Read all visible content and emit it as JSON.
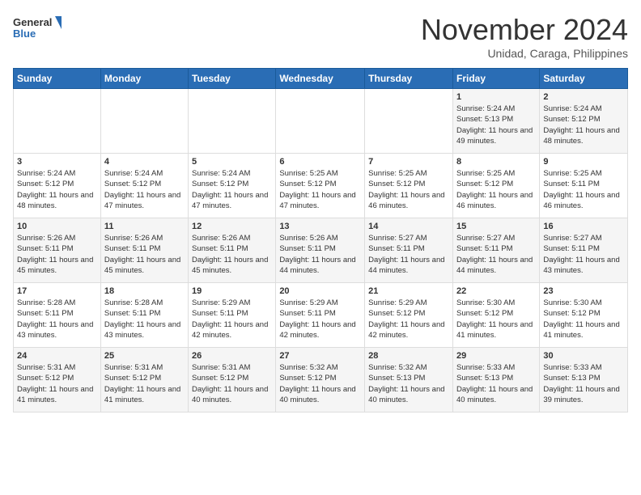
{
  "logo": {
    "line1": "General",
    "line2": "Blue"
  },
  "title": "November 2024",
  "location": "Unidad, Caraga, Philippines",
  "days_header": [
    "Sunday",
    "Monday",
    "Tuesday",
    "Wednesday",
    "Thursday",
    "Friday",
    "Saturday"
  ],
  "weeks": [
    [
      {
        "day": "",
        "data": ""
      },
      {
        "day": "",
        "data": ""
      },
      {
        "day": "",
        "data": ""
      },
      {
        "day": "",
        "data": ""
      },
      {
        "day": "",
        "data": ""
      },
      {
        "day": "1",
        "data": "Sunrise: 5:24 AM\nSunset: 5:13 PM\nDaylight: 11 hours and 49 minutes."
      },
      {
        "day": "2",
        "data": "Sunrise: 5:24 AM\nSunset: 5:12 PM\nDaylight: 11 hours and 48 minutes."
      }
    ],
    [
      {
        "day": "3",
        "data": "Sunrise: 5:24 AM\nSunset: 5:12 PM\nDaylight: 11 hours and 48 minutes."
      },
      {
        "day": "4",
        "data": "Sunrise: 5:24 AM\nSunset: 5:12 PM\nDaylight: 11 hours and 47 minutes."
      },
      {
        "day": "5",
        "data": "Sunrise: 5:24 AM\nSunset: 5:12 PM\nDaylight: 11 hours and 47 minutes."
      },
      {
        "day": "6",
        "data": "Sunrise: 5:25 AM\nSunset: 5:12 PM\nDaylight: 11 hours and 47 minutes."
      },
      {
        "day": "7",
        "data": "Sunrise: 5:25 AM\nSunset: 5:12 PM\nDaylight: 11 hours and 46 minutes."
      },
      {
        "day": "8",
        "data": "Sunrise: 5:25 AM\nSunset: 5:12 PM\nDaylight: 11 hours and 46 minutes."
      },
      {
        "day": "9",
        "data": "Sunrise: 5:25 AM\nSunset: 5:11 PM\nDaylight: 11 hours and 46 minutes."
      }
    ],
    [
      {
        "day": "10",
        "data": "Sunrise: 5:26 AM\nSunset: 5:11 PM\nDaylight: 11 hours and 45 minutes."
      },
      {
        "day": "11",
        "data": "Sunrise: 5:26 AM\nSunset: 5:11 PM\nDaylight: 11 hours and 45 minutes."
      },
      {
        "day": "12",
        "data": "Sunrise: 5:26 AM\nSunset: 5:11 PM\nDaylight: 11 hours and 45 minutes."
      },
      {
        "day": "13",
        "data": "Sunrise: 5:26 AM\nSunset: 5:11 PM\nDaylight: 11 hours and 44 minutes."
      },
      {
        "day": "14",
        "data": "Sunrise: 5:27 AM\nSunset: 5:11 PM\nDaylight: 11 hours and 44 minutes."
      },
      {
        "day": "15",
        "data": "Sunrise: 5:27 AM\nSunset: 5:11 PM\nDaylight: 11 hours and 44 minutes."
      },
      {
        "day": "16",
        "data": "Sunrise: 5:27 AM\nSunset: 5:11 PM\nDaylight: 11 hours and 43 minutes."
      }
    ],
    [
      {
        "day": "17",
        "data": "Sunrise: 5:28 AM\nSunset: 5:11 PM\nDaylight: 11 hours and 43 minutes."
      },
      {
        "day": "18",
        "data": "Sunrise: 5:28 AM\nSunset: 5:11 PM\nDaylight: 11 hours and 43 minutes."
      },
      {
        "day": "19",
        "data": "Sunrise: 5:29 AM\nSunset: 5:11 PM\nDaylight: 11 hours and 42 minutes."
      },
      {
        "day": "20",
        "data": "Sunrise: 5:29 AM\nSunset: 5:11 PM\nDaylight: 11 hours and 42 minutes."
      },
      {
        "day": "21",
        "data": "Sunrise: 5:29 AM\nSunset: 5:12 PM\nDaylight: 11 hours and 42 minutes."
      },
      {
        "day": "22",
        "data": "Sunrise: 5:30 AM\nSunset: 5:12 PM\nDaylight: 11 hours and 41 minutes."
      },
      {
        "day": "23",
        "data": "Sunrise: 5:30 AM\nSunset: 5:12 PM\nDaylight: 11 hours and 41 minutes."
      }
    ],
    [
      {
        "day": "24",
        "data": "Sunrise: 5:31 AM\nSunset: 5:12 PM\nDaylight: 11 hours and 41 minutes."
      },
      {
        "day": "25",
        "data": "Sunrise: 5:31 AM\nSunset: 5:12 PM\nDaylight: 11 hours and 41 minutes."
      },
      {
        "day": "26",
        "data": "Sunrise: 5:31 AM\nSunset: 5:12 PM\nDaylight: 11 hours and 40 minutes."
      },
      {
        "day": "27",
        "data": "Sunrise: 5:32 AM\nSunset: 5:12 PM\nDaylight: 11 hours and 40 minutes."
      },
      {
        "day": "28",
        "data": "Sunrise: 5:32 AM\nSunset: 5:13 PM\nDaylight: 11 hours and 40 minutes."
      },
      {
        "day": "29",
        "data": "Sunrise: 5:33 AM\nSunset: 5:13 PM\nDaylight: 11 hours and 40 minutes."
      },
      {
        "day": "30",
        "data": "Sunrise: 5:33 AM\nSunset: 5:13 PM\nDaylight: 11 hours and 39 minutes."
      }
    ]
  ]
}
